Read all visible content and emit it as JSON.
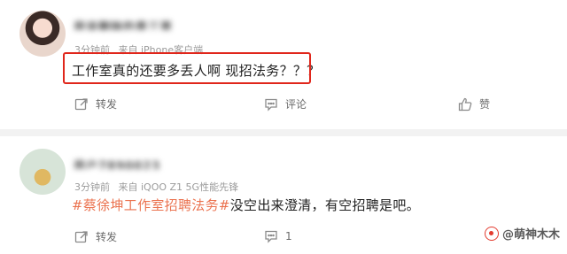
{
  "posts": [
    {
      "username": "用该删除的是三哥",
      "time": "3分钟前",
      "source": "来自 iPhone客户端",
      "comment": "工作室真的还要多丢人啊 现招法务？？？",
      "highlighted": true,
      "highlight_color": "#e0261b",
      "actions": {
        "repost_label": "转发",
        "comment_label": "评论",
        "like_label": "赞",
        "repost_icon": "repost-icon",
        "comment_icon": "comment-icon",
        "like_icon": "thumbs-up-icon"
      }
    },
    {
      "username": "用户7890023",
      "time": "3分钟前",
      "source": "来自 iQOO Z1 5G性能先锋",
      "hashtag": "#蔡徐坤工作室招聘法务#",
      "comment": "没空出来澄清，有空招聘是吧。",
      "hashtag_color": "#eb7350",
      "actions": {
        "repost_label": "转发",
        "comment_count": "1",
        "repost_icon": "repost-icon",
        "comment_icon": "comment-icon"
      }
    }
  ],
  "watermark": {
    "text": "@萌神木木"
  }
}
